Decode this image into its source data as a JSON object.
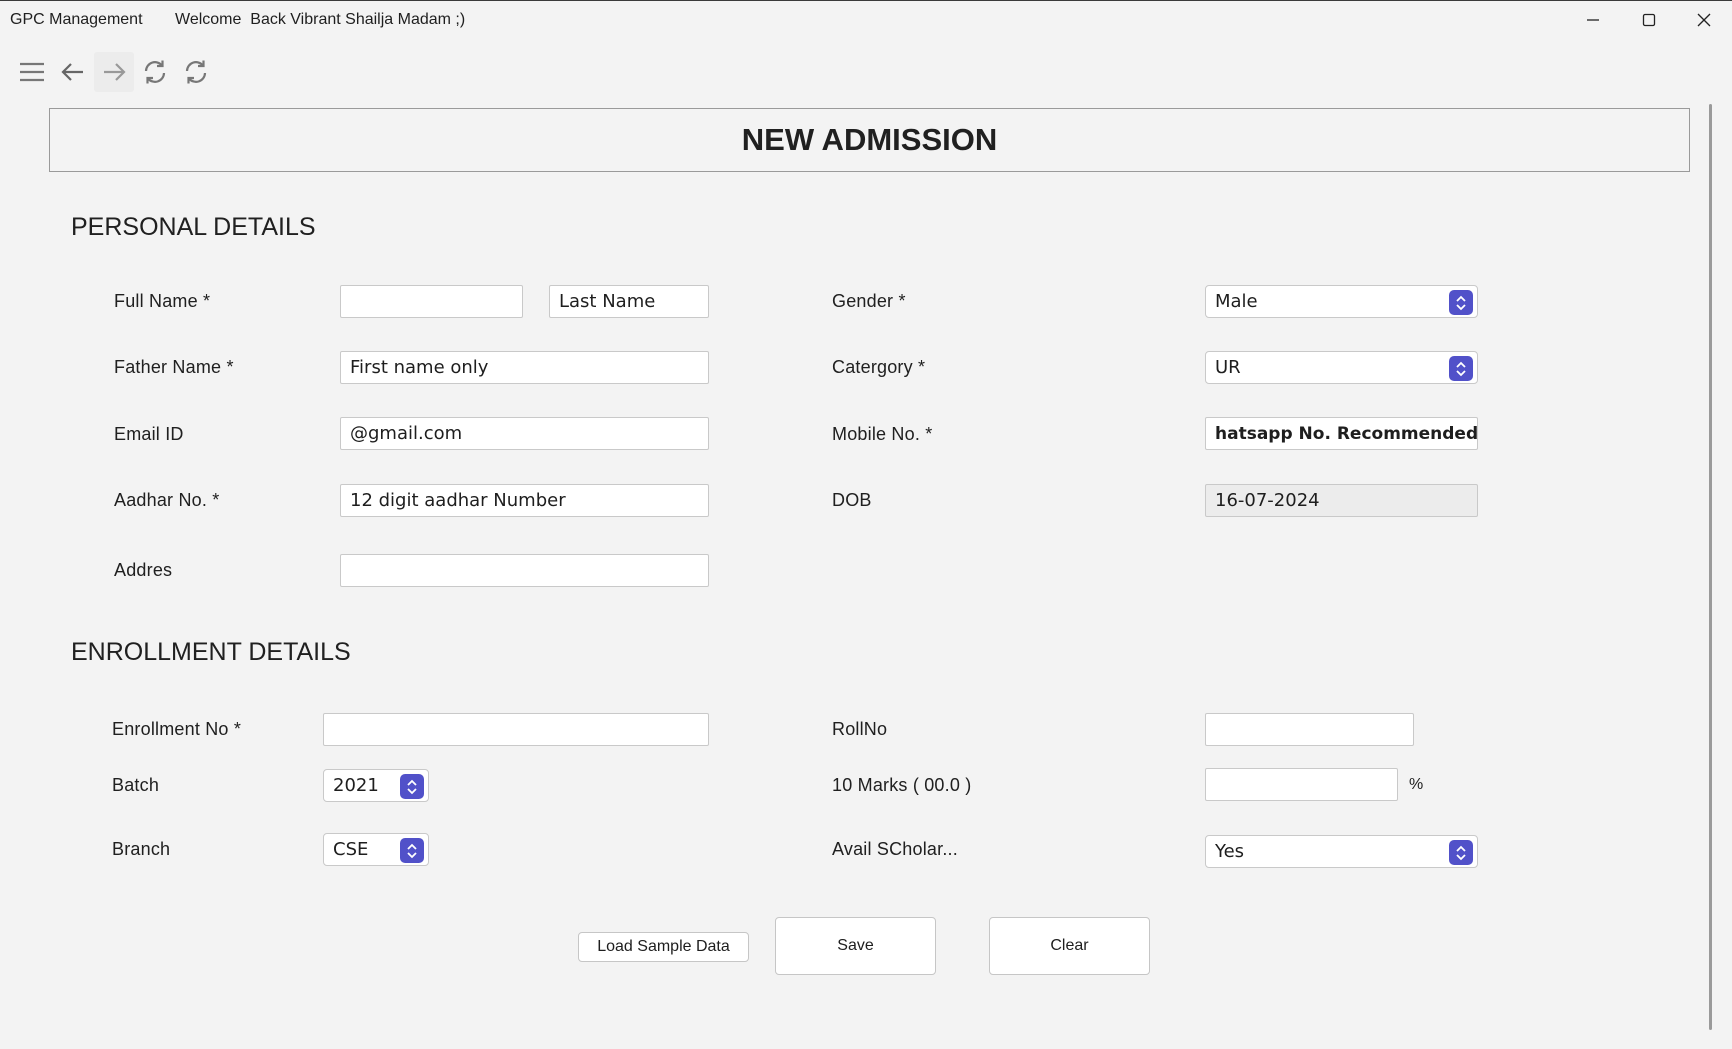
{
  "window": {
    "app_name": "GPC Management",
    "welcome": "Welcome  Back Vibrant Shailja Madam ;)"
  },
  "page": {
    "title": "NEW ADMISSION"
  },
  "personal": {
    "heading": "PERSONAL DETAILS",
    "full_name_label": "Full Name *",
    "first_name_value": "",
    "last_name_value": "Last Name",
    "father_name_label": "Father Name *",
    "father_name_value": "First name only",
    "email_label": "Email ID",
    "email_value": "@gmail.com",
    "aadhar_label": "Aadhar No. *",
    "aadhar_value": "12 digit aadhar Number",
    "address_label": "Addres",
    "address_value": "",
    "gender_label": "Gender *",
    "gender_value": "Male",
    "category_label": "Catergory *",
    "category_value": "UR",
    "mobile_label": "Mobile No. *",
    "mobile_value": "hatsapp No. Recommended",
    "dob_label": "DOB",
    "dob_value": "16-07-2024"
  },
  "enrollment": {
    "heading": "ENROLLMENT DETAILS",
    "enrollment_no_label": "Enrollment No *",
    "enrollment_no_value": "",
    "batch_label": "Batch",
    "batch_value": "2021",
    "branch_label": "Branch",
    "branch_value": "CSE",
    "rollno_label": "RollNo",
    "rollno_value": "",
    "marks_label": "10 Marks ( 00.0 )",
    "marks_value": "",
    "percent_suffix": "%",
    "scholarship_label": "Avail SCholar...",
    "scholarship_value": "Yes"
  },
  "actions": {
    "load_sample": "Load Sample Data",
    "save": "Save",
    "clear": "Clear"
  },
  "colors": {
    "accent": "#5151c9",
    "background": "#f3f3f3"
  }
}
